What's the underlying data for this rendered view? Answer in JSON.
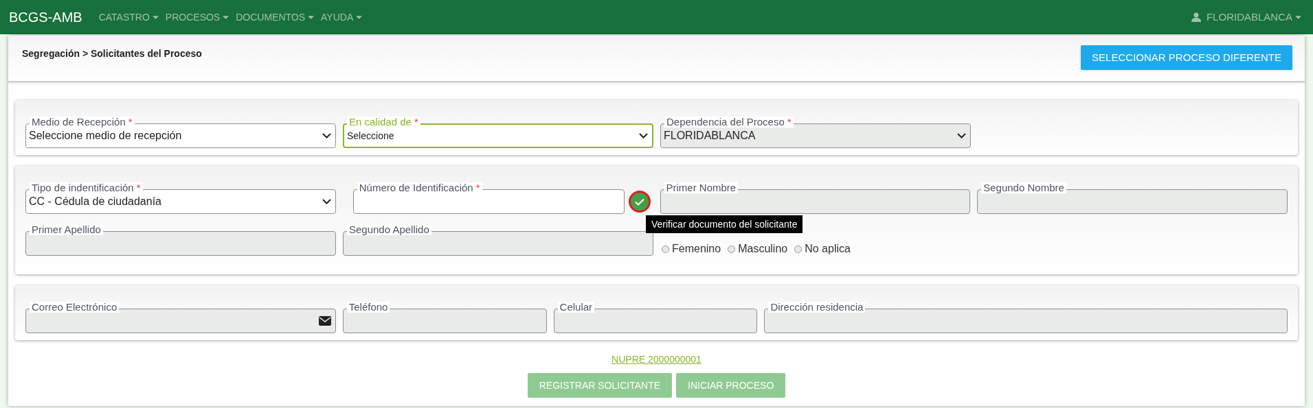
{
  "navbar": {
    "brand": "BCGS-AMB",
    "menus": [
      "CATASTRO",
      "PROCESOS",
      "DOCUMENTOS",
      "AYUDA"
    ],
    "user": "FLORIDABLANCA"
  },
  "header": {
    "breadcrumb": "Segregación > Solicitantes del Proceso",
    "button": "SELECCIONAR PROCESO DIFERENTE"
  },
  "panel_1": {
    "fields": [
      {
        "kind": "select",
        "label": "Medio de Recepción",
        "required_mark": "*",
        "value": "Seleccione medio de recepción",
        "disabled": false,
        "focused": false
      },
      {
        "kind": "select",
        "label": "En calidad de",
        "required_mark": "*",
        "value": "Seleccione",
        "disabled": false,
        "focused": true
      },
      {
        "kind": "select",
        "label": "Dependencia del Proceso",
        "required_mark": "*",
        "value": "FLORIDABLANCA",
        "disabled": true,
        "focused": false
      }
    ]
  },
  "panel_2": {
    "row_1": [
      {
        "kind": "select",
        "label": "Tipo de indentificación",
        "required_mark": "*",
        "value": "CC - Cédula de ciudadanía",
        "disabled": false,
        "focused": false
      },
      {
        "kind": "verify_input",
        "label": "Número de Identificación",
        "required_mark": "*",
        "disabled": false,
        "focused": false
      },
      {
        "kind": "input",
        "label": "Primer Nombre",
        "disabled": true,
        "focused": false
      },
      {
        "kind": "input",
        "label": "Segundo Nombre",
        "disabled": true,
        "focused": false
      }
    ],
    "row_2": [
      {
        "kind": "input",
        "label": "Primer Apellido",
        "disabled": true,
        "focused": false
      },
      {
        "kind": "input",
        "label": "Segundo Apellido",
        "disabled": true,
        "focused": false
      }
    ],
    "gender_options": [
      {
        "label": "Femenino",
        "selected": false
      },
      {
        "label": "Masculino",
        "selected": false
      },
      {
        "label": "No aplica",
        "selected": false
      }
    ],
    "tooltip": "Verificar documento del solicitante"
  },
  "panel_3": {
    "fields": [
      {
        "kind": "email_input",
        "label": "Correo Electrónico",
        "disabled": true,
        "focused": false
      },
      {
        "kind": "input",
        "label": "Teléfono",
        "disabled": true,
        "focused": false
      },
      {
        "kind": "input",
        "label": "Celular",
        "disabled": true,
        "focused": false
      },
      {
        "kind": "input",
        "label": "Dirección residencia",
        "disabled": true,
        "focused": false
      }
    ]
  },
  "nupre_link": "NUPRE 2000000001",
  "buttons": [
    {
      "label": "REGISTRAR SOLICITANTE",
      "disabled": true
    },
    {
      "label": "INICIAR PROCESO",
      "disabled": true
    }
  ]
}
